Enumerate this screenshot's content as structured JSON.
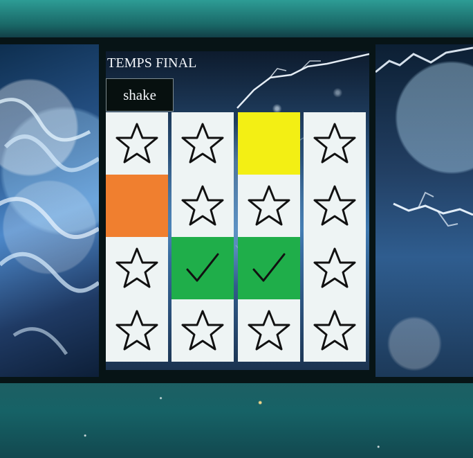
{
  "title": "TEMPS FINAL",
  "shake_button": {
    "label": "shake"
  },
  "board": {
    "rows": 4,
    "columns": 4,
    "tiles": [
      {
        "state": "star",
        "icon": "star-icon"
      },
      {
        "state": "star",
        "icon": "star-icon"
      },
      {
        "state": "yellow",
        "color": "#f3ef14"
      },
      {
        "state": "star",
        "icon": "star-icon"
      },
      {
        "state": "orange",
        "color": "#f07f2f"
      },
      {
        "state": "star",
        "icon": "star-icon"
      },
      {
        "state": "star",
        "icon": "star-icon"
      },
      {
        "state": "star",
        "icon": "star-icon"
      },
      {
        "state": "star",
        "icon": "star-icon"
      },
      {
        "state": "matched",
        "icon": "check-icon",
        "color": "#1fae4a"
      },
      {
        "state": "matched",
        "icon": "check-icon",
        "color": "#1fae4a"
      },
      {
        "state": "star",
        "icon": "star-icon"
      },
      {
        "state": "star",
        "icon": "star-icon"
      },
      {
        "state": "star",
        "icon": "star-icon"
      },
      {
        "state": "star",
        "icon": "star-icon"
      },
      {
        "state": "star",
        "icon": "star-icon"
      }
    ]
  },
  "colors": {
    "background": "#1f6f6d",
    "frame": "#071416",
    "tile": "#eef4f4",
    "yellow": "#f3ef14",
    "orange": "#f07f2f",
    "green": "#1fae4a"
  }
}
